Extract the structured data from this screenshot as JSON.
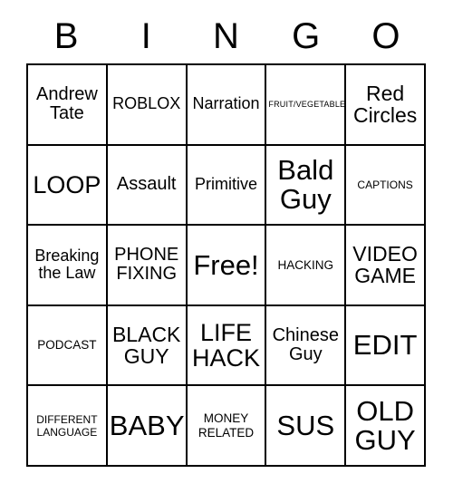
{
  "card": {
    "title": "BINGO",
    "header_letters": [
      "B",
      "I",
      "N",
      "G",
      "O"
    ],
    "free_space_label": "Free!",
    "rows": [
      [
        {
          "text": "Andrew\nTate",
          "size": "ml"
        },
        {
          "text": "ROBLOX",
          "size": "m"
        },
        {
          "text": "Narration",
          "size": "m"
        },
        {
          "text": "FRUIT/VEGETABLE",
          "size": "xxs"
        },
        {
          "text": "Red\nCircles",
          "size": "l"
        }
      ],
      [
        {
          "text": "LOOP",
          "size": "xl"
        },
        {
          "text": "Assault",
          "size": "ml"
        },
        {
          "text": "Primitive",
          "size": "m"
        },
        {
          "text": "Bald\nGuy",
          "size": "xxl"
        },
        {
          "text": "CAPTIONS",
          "size": "xs"
        }
      ],
      [
        {
          "text": "Breaking\nthe Law",
          "size": "m"
        },
        {
          "text": "PHONE\nFIXING",
          "size": "ml"
        },
        {
          "text": "Free!",
          "size": "xxl"
        },
        {
          "text": "HACKING",
          "size": "s"
        },
        {
          "text": "VIDEO\nGAME",
          "size": "l"
        }
      ],
      [
        {
          "text": "PODCAST",
          "size": "s"
        },
        {
          "text": "BLACK\nGUY",
          "size": "l"
        },
        {
          "text": "LIFE\nHACK",
          "size": "xl"
        },
        {
          "text": "Chinese\nGuy",
          "size": "ml"
        },
        {
          "text": "EDIT",
          "size": "xxl"
        }
      ],
      [
        {
          "text": "DIFFERENT\nLANGUAGE",
          "size": "xs"
        },
        {
          "text": "BABY",
          "size": "xxl"
        },
        {
          "text": "MONEY\nRELATED",
          "size": "s"
        },
        {
          "text": "SUS",
          "size": "xxl"
        },
        {
          "text": "OLD\nGUY",
          "size": "xxl"
        }
      ]
    ]
  },
  "style": {
    "background_color": "#ffffff",
    "text_color": "#000000",
    "border_color": "#000000"
  }
}
